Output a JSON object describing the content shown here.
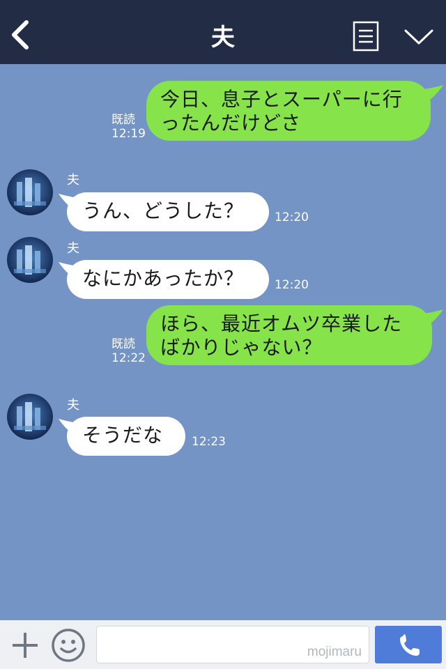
{
  "header": {
    "title": "夫",
    "back_icon": "chevron-left-icon",
    "menu_icon": "note-list-icon",
    "dropdown_icon": "chevron-down-icon",
    "background": "#232c45"
  },
  "chat": {
    "background": "#7394c4",
    "outgoing_color": "#86e34a",
    "incoming_color": "#ffffff",
    "messages": [
      {
        "direction": "out",
        "lines": [
          "今日、息子とスーパーに行",
          "ったんだけどさ"
        ],
        "read": "既読",
        "time": "12:19"
      },
      {
        "direction": "in",
        "sender": "夫",
        "text": "うん、どうした？",
        "time": "12:20"
      },
      {
        "direction": "in",
        "sender": "夫",
        "text": "なにかあったか？",
        "time": "12:20"
      },
      {
        "direction": "out",
        "lines": [
          "ほら、最近オムツ卒業した",
          "ばかりじゃない？"
        ],
        "read": "既読",
        "time": "12:22"
      },
      {
        "direction": "in",
        "sender": "夫",
        "text": "そうだな",
        "time": "12:23"
      }
    ]
  },
  "input_bar": {
    "watermark": "mojimaru",
    "plus_icon": "plus-icon",
    "emoji_icon": "smiley-icon",
    "call_icon": "phone-icon",
    "call_color": "#4f7bd9"
  }
}
